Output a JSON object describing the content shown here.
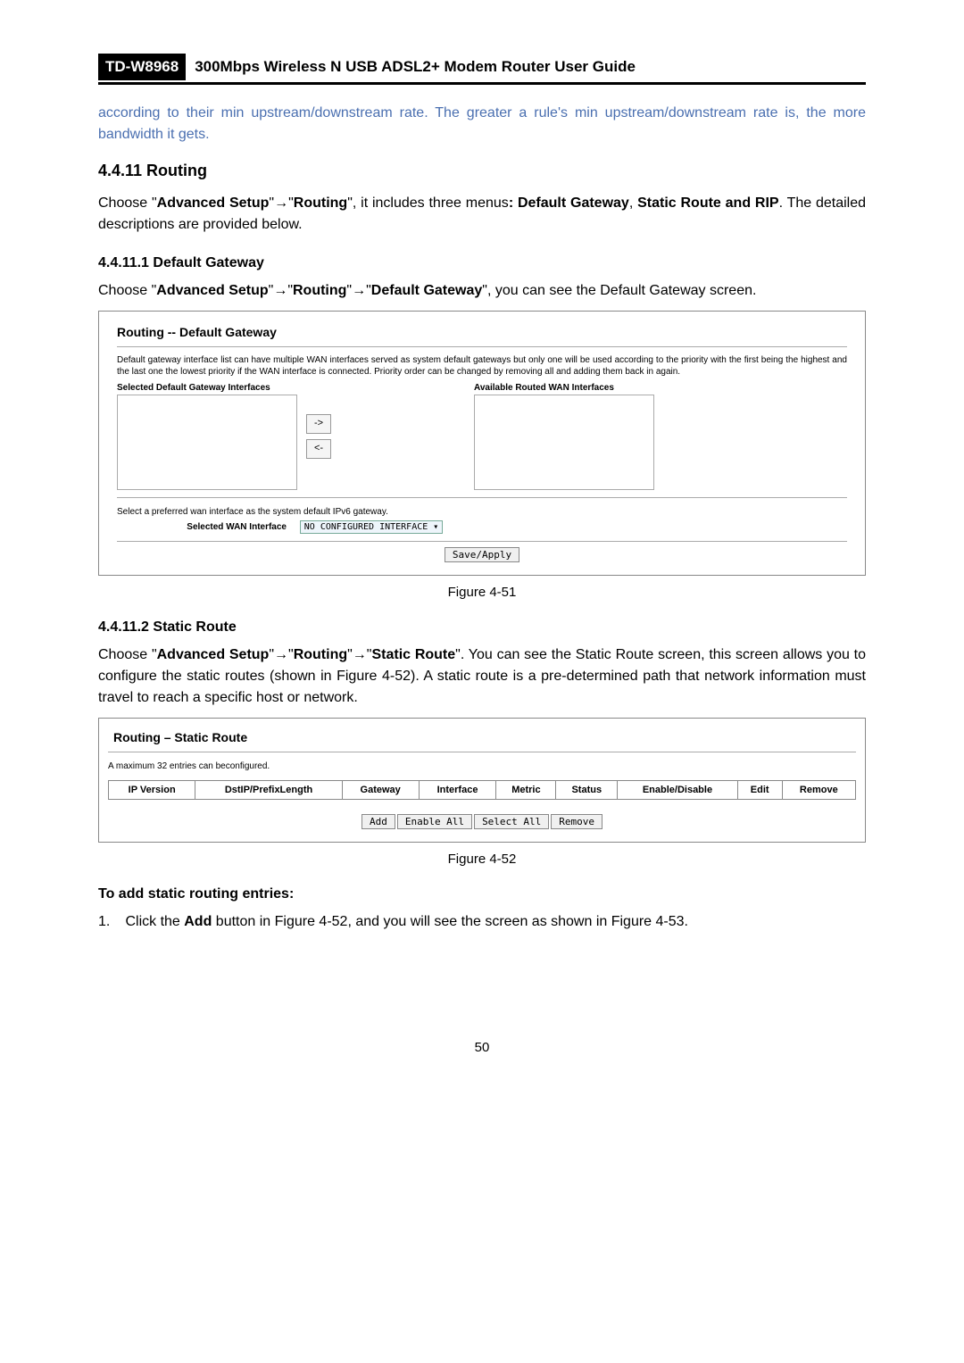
{
  "header": {
    "model": "TD-W8968",
    "title": "300Mbps Wireless N USB ADSL2+ Modem Router User Guide"
  },
  "intro_note": "according to their min upstream/downstream rate. The greater a rule's min upstream/downstream rate is, the more bandwidth it gets.",
  "section_heading": "4.4.11 Routing",
  "routing_intro_1": "Choose \"",
  "routing_intro_adv": "Advanced Setup",
  "routing_intro_2": "\"→\"",
  "routing_intro_routing": "Routing",
  "routing_intro_3": "\", it includes three menus",
  "routing_intro_4": ": Default Gateway",
  "routing_intro_5": ", ",
  "routing_intro_6": "Static Route and RIP",
  "routing_intro_7": ". The detailed descriptions are provided below.",
  "dg": {
    "heading": "4.4.11.1 Default Gateway",
    "intro_1": "Choose \"",
    "intro_adv": "Advanced Setup",
    "intro_2": "\"→\"",
    "intro_routing": "Routing",
    "intro_3": "\"→\"",
    "intro_dg": "Default Gateway",
    "intro_4": "\", you can see the Default Gateway screen.",
    "fig_title": "Routing -- Default Gateway",
    "fig_desc": "Default gateway interface list can have multiple WAN interfaces served as system default gateways but only one will be used according to the priority with the first being the highest and the last one the lowest priority if the WAN interface is connected. Priority order can be changed by removing all and adding them back in again.",
    "selected_label": "Selected Default Gateway Interfaces",
    "available_label": "Available Routed WAN Interfaces",
    "move_right": "->",
    "move_left": "<-",
    "ipv6_note": "Select a preferred wan interface as the system default IPv6 gateway.",
    "ipv6_label": "Selected WAN Interface",
    "ipv6_value": "NO CONFIGURED INTERFACE ▾",
    "save_btn": "Save/Apply",
    "caption": "Figure 4-51"
  },
  "sr": {
    "heading": "4.4.11.2 Static Route",
    "intro_1": "Choose \"",
    "intro_adv": "Advanced Setup",
    "intro_2": "\"→\"",
    "intro_routing": "Routing",
    "intro_3": "\"→\"",
    "intro_sr": "Static Route",
    "intro_4": "\". You can see the Static Route screen, this screen allows you to configure the static routes (shown in Figure 4-52). A static route is a pre-determined path that network information must travel to reach a specific host or network.",
    "fig_title": "Routing – Static Route",
    "max_note": "A maximum 32 entries can beconfigured.",
    "cols": {
      "c1": "IP Version",
      "c2": "DstIP/PrefixLength",
      "c3": "Gateway",
      "c4": "Interface",
      "c5": "Metric",
      "c6": "Status",
      "c7": "Enable/Disable",
      "c8": "Edit",
      "c9": "Remove"
    },
    "btn_add": "Add",
    "btn_enable": "Enable All",
    "btn_select": "Select All",
    "btn_remove": "Remove",
    "caption": "Figure 4-52"
  },
  "add_entries": {
    "heading": "To add static routing entries:",
    "step1_num": "1.",
    "step1_a": "Click the ",
    "step1_b": "Add",
    "step1_c": " button in Figure 4-52, and you will see the screen as shown in Figure 4-53."
  },
  "page_number": "50"
}
